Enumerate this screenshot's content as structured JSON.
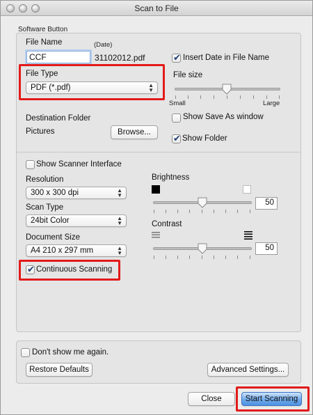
{
  "window": {
    "title": "Scan to File"
  },
  "group": {
    "label": "Software Button"
  },
  "file": {
    "name_label": "File Name",
    "date_label": "(Date)",
    "name_value": "CCF",
    "date_value": "31102012.pdf",
    "insert_date_label": "Insert Date in File Name",
    "insert_date_checked": true
  },
  "file_type": {
    "label": "File Type",
    "value": "PDF (*.pdf)"
  },
  "file_size": {
    "label": "File size",
    "min_label": "Small",
    "max_label": "Large",
    "level": 0.5
  },
  "show_save_as": {
    "label": "Show Save As window",
    "checked": false
  },
  "destination": {
    "label": "Destination Folder",
    "folder": "Pictures",
    "browse_label": "Browse...",
    "show_folder_label": "Show Folder",
    "show_folder_checked": true
  },
  "scanner": {
    "show_interface_label": "Show Scanner Interface",
    "show_interface_checked": false,
    "resolution_label": "Resolution",
    "resolution_value": "300 x 300 dpi",
    "scan_type_label": "Scan Type",
    "scan_type_value": "24bit Color",
    "document_size_label": "Document Size",
    "document_size_value": "A4 210 x 297 mm",
    "continuous_label": "Continuous Scanning",
    "continuous_checked": true
  },
  "brightness": {
    "label": "Brightness",
    "value": "50",
    "level": 0.5
  },
  "contrast": {
    "label": "Contrast",
    "value": "50",
    "level": 0.5
  },
  "footer": {
    "dont_show_label": "Don't show me again.",
    "dont_show_checked": false,
    "restore_label": "Restore Defaults",
    "advanced_label": "Advanced Settings...",
    "close_label": "Close",
    "start_label": "Start Scanning"
  }
}
